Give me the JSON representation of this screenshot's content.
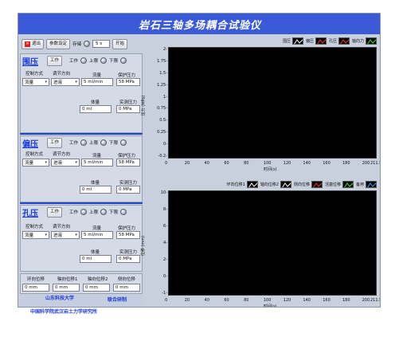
{
  "window": {
    "title": "岩石三轴多场耦合试验仪"
  },
  "toolbar": {
    "exit_label": "退出",
    "params_label": "参数设定",
    "save_label": "存储",
    "interval_value": "5 s",
    "start_label": "开始"
  },
  "panels": [
    {
      "name": "围压",
      "work_label": "工作",
      "led1_label": "工作",
      "led2_label": "上限",
      "led3_label": "下限",
      "ctrl_mode_label": "控制方式",
      "ctrl_mode_value": "流量",
      "dir_label": "调节方向",
      "dir_value": "进液",
      "flow_label": "流量",
      "flow_value": "5 ml/min",
      "protect_label": "保护压力",
      "protect_value": "58 MPa",
      "volume_label": "体量",
      "volume_value": "0 ml",
      "realp_label": "实测压力",
      "realp_value": "0 MPa"
    },
    {
      "name": "偏压",
      "work_label": "工作",
      "led1_label": "工作",
      "led2_label": "上限",
      "led3_label": "下限",
      "ctrl_mode_label": "控制方式",
      "ctrl_mode_value": "流量",
      "dir_label": "调节方向",
      "dir_value": "进液",
      "flow_label": "流量",
      "flow_value": "5 ml/min",
      "protect_label": "保护压力",
      "protect_value": "58 MPa",
      "volume_label": "体量",
      "volume_value": "0 ml",
      "realp_label": "实测压力",
      "realp_value": "0 MPa"
    },
    {
      "name": "孔压",
      "work_label": "工作",
      "led1_label": "工作",
      "led2_label": "上限",
      "led3_label": "下限",
      "ctrl_mode_label": "控制方式",
      "ctrl_mode_value": "流量",
      "dir_label": "调节方向",
      "dir_value": "进液",
      "flow_label": "流量",
      "flow_value": "5 ml/min",
      "protect_label": "保护压力",
      "protect_value": "58 MPa",
      "volume_label": "体量",
      "volume_value": "0 ml",
      "realp_label": "实测压力",
      "realp_value": "0 MPa"
    }
  ],
  "displacement": {
    "labels": [
      "环向位移",
      "轴向位移1",
      "轴向位移2",
      "侧向位移"
    ],
    "values": [
      "0 mm",
      "0 mm",
      "0 mm",
      "0 mm"
    ]
  },
  "orgs": {
    "univ": "山东科技大学",
    "coop": "联合研制",
    "inst": "中国科学院武汉岩土力学研究所"
  },
  "chart_data": [
    {
      "type": "line",
      "ylabel": "压力 (MPa)",
      "xlabel": "时间(s)",
      "yticks": [
        "2-",
        "1.75-",
        "1.5-",
        "1.25-",
        "1-",
        "0.75-",
        "0.5-",
        "0.25-",
        "0-",
        "-0.2-"
      ],
      "xticks": [
        "0",
        "20",
        "40",
        "60",
        "80",
        "100",
        "120",
        "140",
        "160",
        "180",
        "200",
        "211.5"
      ],
      "xlim": [
        0,
        211.5
      ],
      "ylim": [
        -0.2,
        2
      ],
      "legend": [
        "围压",
        "偏压",
        "孔压",
        "轴向力"
      ],
      "legend_colors": [
        "#ffffff",
        "#ff3333",
        "#ff3333",
        "#33ee33"
      ],
      "series": []
    },
    {
      "type": "line",
      "ylabel": "位移 (mm)",
      "xlabel": "时间(s)",
      "yticks": [
        "10-",
        "8-",
        "6-",
        "4-",
        "2-",
        "0-",
        "-1-"
      ],
      "xticks": [
        "0",
        "20",
        "40",
        "60",
        "80",
        "100",
        "120",
        "140",
        "160",
        "180",
        "200",
        "211.5"
      ],
      "xlim": [
        0,
        211.5
      ],
      "ylim": [
        -1,
        10
      ],
      "legend": [
        "环向位移1",
        "轴向位移2",
        "侧向位移",
        "活塞位移",
        "备用"
      ],
      "legend_colors": [
        "#ffffff",
        "#ffffff",
        "#ff3333",
        "#33ee33",
        "#33aaff"
      ],
      "series": []
    }
  ]
}
